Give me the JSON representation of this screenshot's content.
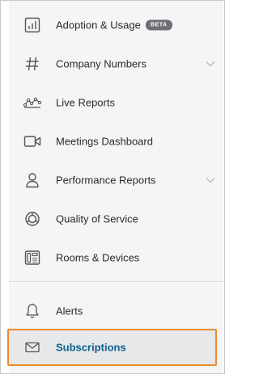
{
  "menu": {
    "items": [
      {
        "label": "Adoption & Usage",
        "badge": "BETA"
      },
      {
        "label": "Company Numbers",
        "expandable": true
      },
      {
        "label": "Live Reports"
      },
      {
        "label": "Meetings Dashboard"
      },
      {
        "label": "Performance Reports",
        "expandable": true
      },
      {
        "label": "Quality of Service"
      },
      {
        "label": "Rooms & Devices"
      }
    ],
    "bottom_items": [
      {
        "label": "Alerts"
      },
      {
        "label": "Subscriptions",
        "active": true
      }
    ]
  },
  "colors": {
    "active_text": "#0b5f8a",
    "highlight_border": "#ef8a2e",
    "menu_background": "#f4f5f6",
    "icon": "#555555"
  },
  "icons": [
    "bar-chart-icon",
    "hash-icon",
    "line-graph-icon",
    "video-camera-icon",
    "person-icon",
    "quality-ring-icon",
    "phone-device-icon",
    "bell-icon",
    "envelope-icon",
    "chevron-down-icon"
  ]
}
